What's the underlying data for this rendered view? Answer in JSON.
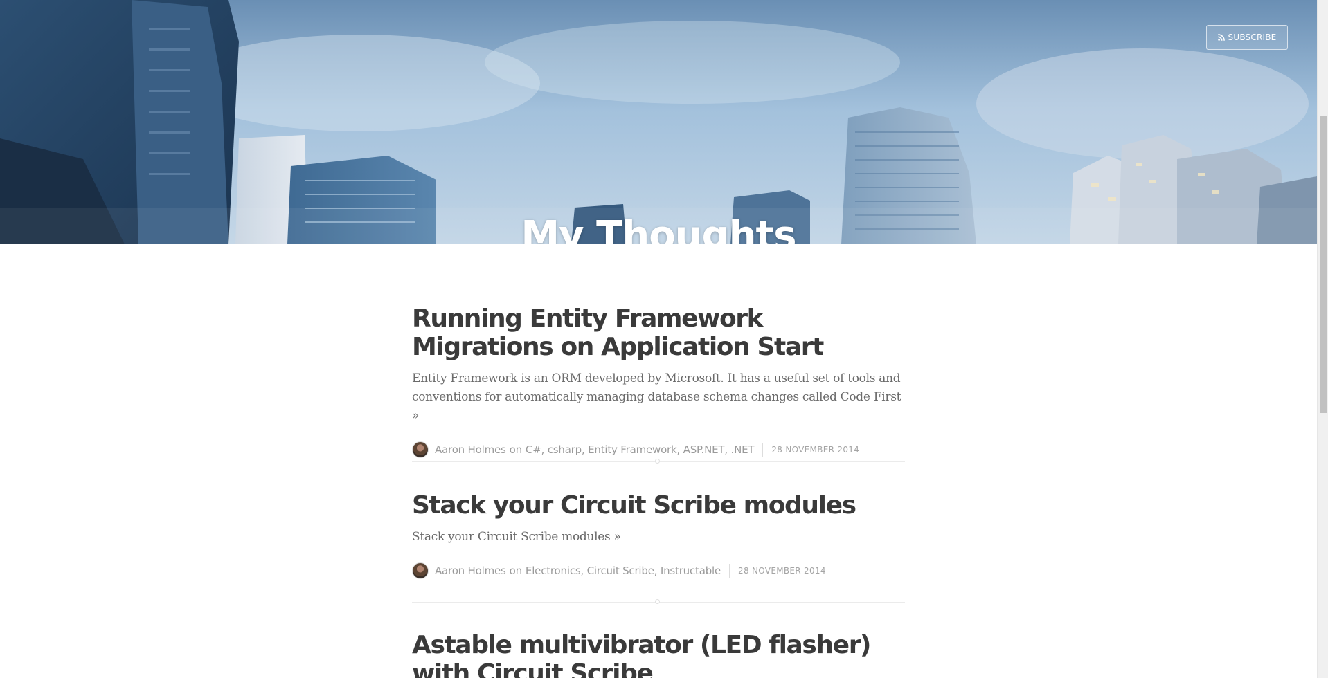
{
  "header": {
    "blog_title": "My Thoughts",
    "subscribe_label": "SUBSCRIBE"
  },
  "posts": [
    {
      "title": "Running Entity Framework Migrations on Application Start",
      "excerpt": "Entity Framework is an ORM developed by Microsoft. It has a useful set of tools and conventions for automatically managing database schema changes called Code First »",
      "author": "Aaron Holmes",
      "on": "on",
      "tags": [
        "C#",
        "csharp",
        "Entity Framework",
        "ASP.NET",
        ".NET"
      ],
      "date": "28 NOVEMBER 2014"
    },
    {
      "title": "Stack your Circuit Scribe modules",
      "excerpt": "Stack your Circuit Scribe modules »",
      "author": "Aaron Holmes",
      "on": "on",
      "tags": [
        "Electronics",
        "Circuit Scribe",
        "Instructable"
      ],
      "date": "28 NOVEMBER 2014"
    },
    {
      "title": "Astable multivibrator (LED flasher) with Circuit Scribe"
    }
  ],
  "colors": {
    "title_text": "#3a3a3a",
    "excerpt_text": "#6a6a6a",
    "meta_text": "#9a9a9a"
  },
  "icons": {
    "subscribe": "rss-icon"
  }
}
